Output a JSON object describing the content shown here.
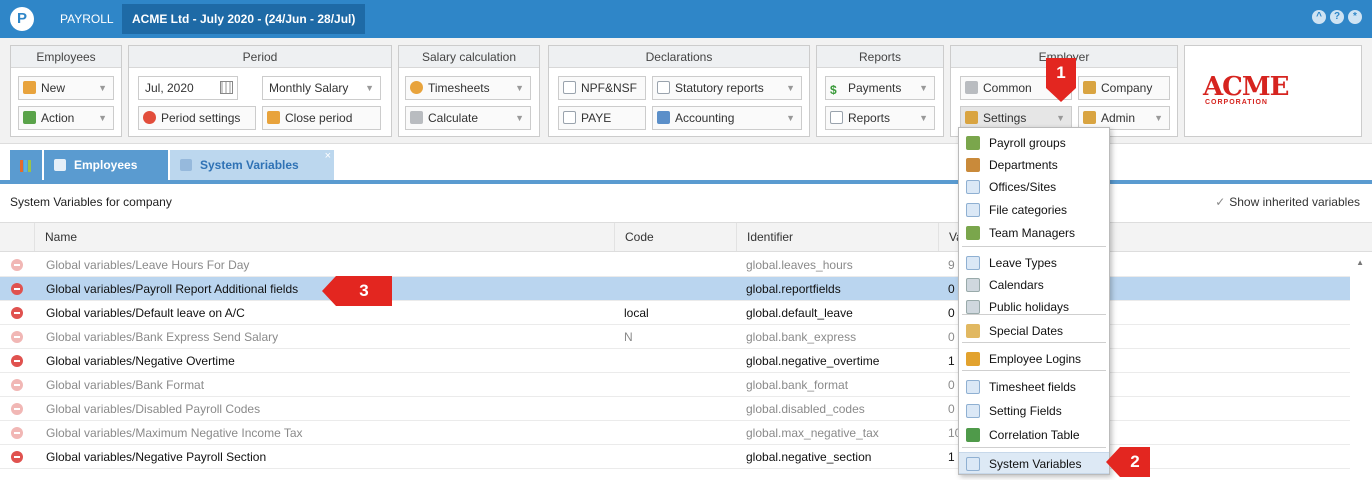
{
  "titlebar": {
    "logo_letter": "P",
    "app_name": "PAYROLL",
    "period_badge": "ACME Ltd - July 2020 - (24/Jun - 28/Jul)",
    "icons": [
      "up-icon",
      "help-icon",
      "gear-icon"
    ]
  },
  "ribbon": {
    "employees": {
      "title": "Employees",
      "new": "New",
      "action": "Action"
    },
    "period": {
      "title": "Period",
      "month": "Jul, 2020",
      "salary_type": "Monthly Salary",
      "settings": "Period settings",
      "close": "Close period"
    },
    "salary": {
      "title": "Salary calculation",
      "timesheets": "Timesheets",
      "calculate": "Calculate"
    },
    "declarations": {
      "title": "Declarations",
      "npf": "NPF&NSF",
      "statutory": "Statutory reports",
      "paye": "PAYE",
      "accounting": "Accounting"
    },
    "reports": {
      "title": "Reports",
      "payments": "Payments",
      "reports": "Reports"
    },
    "employer": {
      "title": "Employer",
      "common": "Common",
      "company": "Company",
      "settings": "Settings",
      "admin": "Admin"
    },
    "logo": {
      "name": "ACME",
      "sub": "CORPORATION"
    }
  },
  "tabs": {
    "employees": "Employees",
    "system_variables": "System Variables",
    "close": "×"
  },
  "panel": {
    "title": "System Variables for company",
    "show_inherited": "Show inherited variables"
  },
  "grid": {
    "columns": [
      "Name",
      "Code",
      "Identifier",
      "Va"
    ],
    "rows": [
      {
        "name": "Global variables/Leave Hours For Day",
        "code": "",
        "identifier": "global.leaves_hours",
        "value": "9",
        "active": false,
        "selected": false
      },
      {
        "name": "Global variables/Payroll Report Additional fields",
        "code": "",
        "identifier": "global.reportfields",
        "value": "0",
        "active": true,
        "selected": true
      },
      {
        "name": "Global variables/Default leave on A/C",
        "code": "local",
        "identifier": "global.default_leave",
        "value": "0",
        "active": true,
        "selected": false
      },
      {
        "name": "Global variables/Bank Express Send Salary",
        "code": "N",
        "identifier": "global.bank_express",
        "value": "0",
        "active": false,
        "selected": false
      },
      {
        "name": "Global variables/Negative Overtime",
        "code": "",
        "identifier": "global.negative_overtime",
        "value": "1",
        "active": true,
        "selected": false
      },
      {
        "name": "Global variables/Bank Format",
        "code": "",
        "identifier": "global.bank_format",
        "value": "0",
        "active": false,
        "selected": false
      },
      {
        "name": "Global variables/Disabled Payroll Codes",
        "code": "",
        "identifier": "global.disabled_codes",
        "value": "0",
        "active": false,
        "selected": false
      },
      {
        "name": "Global variables/Maximum Negative Income Tax",
        "code": "",
        "identifier": "global.max_negative_tax",
        "value": "10",
        "active": false,
        "selected": false
      },
      {
        "name": "Global variables/Negative Payroll Section",
        "code": "",
        "identifier": "global.negative_section",
        "value": "1",
        "active": true,
        "selected": false
      }
    ]
  },
  "settings_menu": [
    {
      "label": "Payroll groups",
      "icon": "people-icon"
    },
    {
      "label": "Departments",
      "icon": "department-icon"
    },
    {
      "label": "Offices/Sites",
      "icon": "document-icon"
    },
    {
      "label": "File categories",
      "icon": "document-icon"
    },
    {
      "label": "Team Managers",
      "icon": "people-icon"
    },
    {
      "label": "Leave Types",
      "icon": "document-icon"
    },
    {
      "label": "Calendars",
      "icon": "calendar-icon"
    },
    {
      "label": "Public holidays",
      "icon": "calendar-icon"
    },
    {
      "label": "Special Dates",
      "icon": "star-icon"
    },
    {
      "label": "Employee Logins",
      "icon": "lock-icon"
    },
    {
      "label": "Timesheet fields",
      "icon": "document-icon"
    },
    {
      "label": "Setting Fields",
      "icon": "document-icon"
    },
    {
      "label": "Correlation Table",
      "icon": "correlation-icon"
    },
    {
      "label": "System Variables",
      "icon": "document-icon"
    }
  ],
  "callouts": [
    "1",
    "2",
    "3"
  ]
}
